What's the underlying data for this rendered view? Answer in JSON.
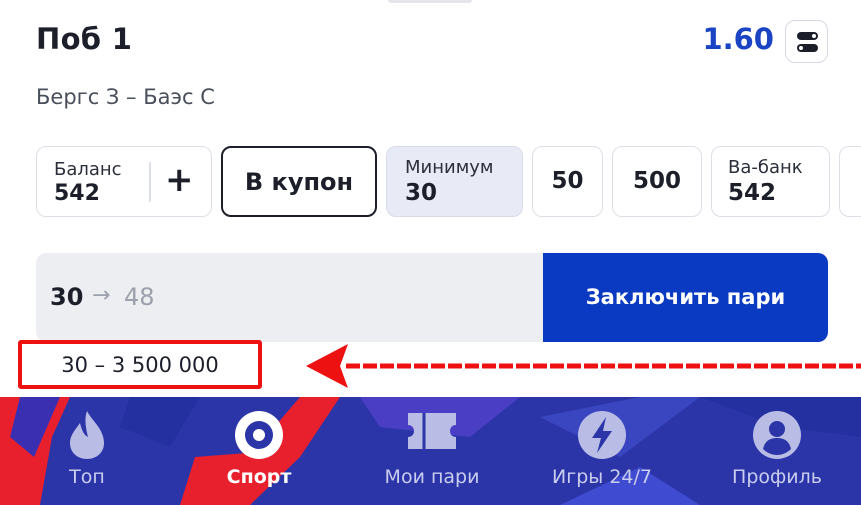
{
  "bet": {
    "title": "Поб 1",
    "odds": "1.60",
    "match": "Бергс З – Баэс С"
  },
  "stake_options": {
    "balance_label": "Баланс",
    "balance_value": "542",
    "plus": "+",
    "coupon_label": "В купон",
    "minimum_label": "Минимум",
    "minimum_value": "30",
    "option_50": "50",
    "option_500": "500",
    "vabank_label": "Ва-банк",
    "vabank_value": "542"
  },
  "amount": {
    "stake": "30",
    "arrow": "→",
    "potential_win": "48"
  },
  "place_bet_label": "Заключить пари",
  "limits": "30 – 3 500 000",
  "nav": {
    "active": "sport",
    "items": [
      {
        "id": "top",
        "label": "Топ",
        "icon": "flame-icon"
      },
      {
        "id": "sport",
        "label": "Спорт",
        "icon": "target-icon"
      },
      {
        "id": "my-bets",
        "label": "Мои пари",
        "icon": "ticket-icon"
      },
      {
        "id": "games",
        "label": "Игры 24/7",
        "icon": "lightning-icon"
      },
      {
        "id": "profile",
        "label": "Профиль",
        "icon": "user-icon"
      }
    ]
  },
  "colors": {
    "accent": "#0a3ac2",
    "odds": "#1a44c4",
    "nav_background": "#2b35a8",
    "annotation": "#ee1111"
  }
}
